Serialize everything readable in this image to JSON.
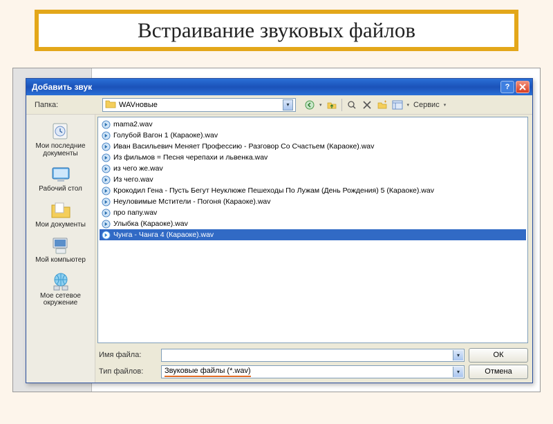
{
  "slide": {
    "title": "Встраивание звуковых файлов"
  },
  "dialog": {
    "title": "Добавить звук",
    "folder_label": "Папка:",
    "folder_name": "WAVновые",
    "tools_label": "Сервис",
    "places": [
      {
        "id": "recent",
        "label": "Мои последние документы"
      },
      {
        "id": "desktop",
        "label": "Рабочий стол"
      },
      {
        "id": "mydocs",
        "label": "Мои документы"
      },
      {
        "id": "mycomp",
        "label": "Мой компьютер"
      },
      {
        "id": "network",
        "label": "Мое сетевое окружение"
      }
    ],
    "files": [
      {
        "name": "mama2.wav",
        "selected": false
      },
      {
        "name": "Голубой Вагон 1 (Караоке).wav",
        "selected": false
      },
      {
        "name": "Иван Васильевич Меняет Профессию - Разговор Со Счастьем (Караоке).wav",
        "selected": false
      },
      {
        "name": "Из фильмов = Песня черепахи и львенка.wav",
        "selected": false
      },
      {
        "name": "из чего же.wav",
        "selected": false
      },
      {
        "name": "Из чего.wav",
        "selected": false
      },
      {
        "name": "Крокодил Гена - Пусть Бегут Неуклюже Пешеходы По Лужам (День Рождения) 5 (Караоке).wav",
        "selected": false
      },
      {
        "name": "Неуловимые Мстители - Погоня (Караоке).wav",
        "selected": false
      },
      {
        "name": "про папу.wav",
        "selected": false
      },
      {
        "name": "Улыбка (Караоке).wav",
        "selected": false
      },
      {
        "name": "Чунга - Чанга 4 (Караоке).wav",
        "selected": true
      }
    ],
    "filename_label": "Имя файла:",
    "filename_value": "",
    "filetype_label": "Тип файлов:",
    "filetype_value": "Звуковые файлы (*.wav)",
    "btn_ok": "ОК",
    "btn_cancel": "Отмена"
  }
}
